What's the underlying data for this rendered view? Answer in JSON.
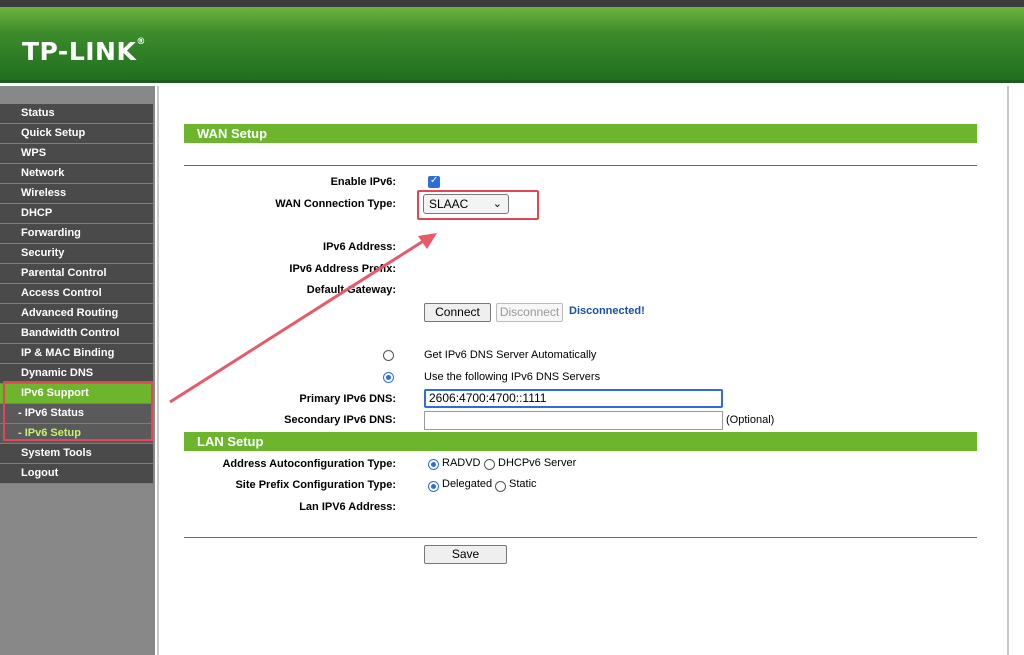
{
  "brand": {
    "logo": "TP-LINK",
    "reg_mark": "®"
  },
  "sidebar": {
    "items": [
      {
        "label": "Status"
      },
      {
        "label": "Quick Setup"
      },
      {
        "label": "WPS"
      },
      {
        "label": "Network"
      },
      {
        "label": "Wireless"
      },
      {
        "label": "DHCP"
      },
      {
        "label": "Forwarding"
      },
      {
        "label": "Security"
      },
      {
        "label": "Parental Control"
      },
      {
        "label": "Access Control"
      },
      {
        "label": "Advanced Routing"
      },
      {
        "label": "Bandwidth Control"
      },
      {
        "label": "IP & MAC Binding"
      },
      {
        "label": "Dynamic DNS"
      },
      {
        "label": "IPv6 Support"
      },
      {
        "label": "- IPv6 Status"
      },
      {
        "label": "- IPv6 Setup"
      },
      {
        "label": "System Tools"
      },
      {
        "label": "Logout"
      }
    ]
  },
  "wan": {
    "title": "WAN Setup",
    "enable_ipv6_label": "Enable IPv6:",
    "enable_ipv6_checked": true,
    "connection_type_label": "WAN Connection Type:",
    "connection_type_value": "SLAAC",
    "ipv6_address_label": "IPv6 Address:",
    "ipv6_prefix_label": "IPv6 Address Prefix:",
    "default_gateway_label": "Default Gateway:",
    "connect_label": "Connect",
    "disconnect_label": "Disconnect",
    "status_text": "Disconnected!",
    "dns_auto_label": "Get IPv6 DNS Server Automatically",
    "dns_manual_label": "Use the following IPv6 DNS Servers",
    "primary_dns_label": "Primary IPv6 DNS:",
    "primary_dns_value": "2606:4700:4700::1111",
    "secondary_dns_label": "Secondary IPv6 DNS:",
    "secondary_dns_value": "",
    "optional_text": "(Optional)"
  },
  "lan": {
    "title": "LAN Setup",
    "autoconfig_label": "Address Autoconfiguration Type:",
    "autoconfig_opt1": "RADVD",
    "autoconfig_opt2": "DHCPv6 Server",
    "prefix_config_label": "Site Prefix Configuration Type:",
    "prefix_opt1": "Delegated",
    "prefix_opt2": "Static",
    "lan_address_label": "Lan IPV6 Address:",
    "save_label": "Save"
  },
  "colors": {
    "accent_green": "#6cb52d",
    "header_green": "#2f7e27",
    "menu_dark": "#4a4a4a",
    "highlight_red": "#e04658",
    "link_blue": "#1a4fa8"
  }
}
